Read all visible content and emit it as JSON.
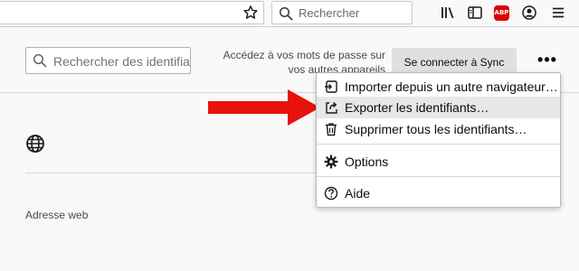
{
  "browser": {
    "search_placeholder": "Rechercher",
    "abp_label": "ABP"
  },
  "header": {
    "search_placeholder": "Rechercher des identifia",
    "sync_text_line1": "Accédez à vos mots de passe sur",
    "sync_text_line2": "vos autres appareils",
    "sync_button": "Se connecter à Sync",
    "more_button": "•••"
  },
  "content": {
    "web_address_label": "Adresse web"
  },
  "menu": {
    "items": [
      {
        "label": "Importer depuis un autre navigateur…",
        "icon": "import-icon"
      },
      {
        "label": "Exporter les identifiants…",
        "icon": "export-icon"
      },
      {
        "label": "Supprimer tous les identifiants…",
        "icon": "trash-icon"
      },
      {
        "label": "Options",
        "icon": "gear-icon"
      },
      {
        "label": "Aide",
        "icon": "help-icon"
      }
    ],
    "highlighted_item": "Exporter les identifiants…"
  },
  "colors": {
    "arrow": "#e8120c",
    "abp": "#dd0000",
    "highlight": "#e7e7e9"
  }
}
